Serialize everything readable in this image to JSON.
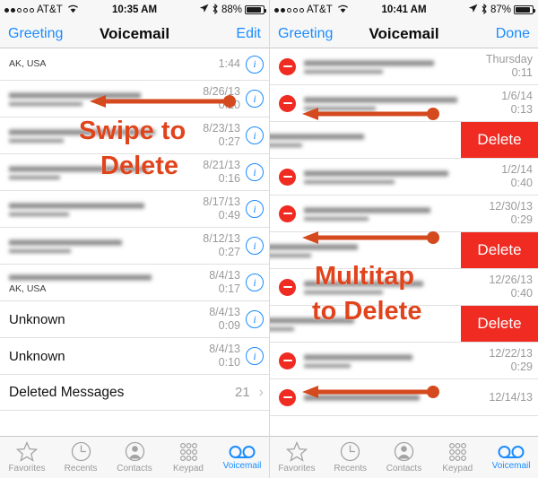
{
  "left": {
    "status": {
      "carrier": "AT&T",
      "signal_filled": 2,
      "signal_total": 5,
      "time": "10:35 AM",
      "battery": "88%"
    },
    "nav": {
      "left": "Greeting",
      "title": "Voicemail",
      "right": "Edit"
    },
    "rows": [
      {
        "name": "",
        "sub": "AK, USA",
        "date": "",
        "dur": "1:44",
        "blur_name": true,
        "partial": true
      },
      {
        "name": "",
        "sub": "",
        "date": "8/26/13",
        "dur": "0:20",
        "blur_name": true,
        "blur_sub": true
      },
      {
        "name": "",
        "sub": "",
        "date": "8/23/13",
        "dur": "0:27",
        "blur_name": true,
        "blur_sub": true
      },
      {
        "name": "",
        "sub": "",
        "date": "8/21/13",
        "dur": "0:16",
        "blur_name": true,
        "blur_sub": true
      },
      {
        "name": "",
        "sub": "",
        "date": "8/17/13",
        "dur": "0:49",
        "blur_name": true,
        "blur_sub": true
      },
      {
        "name": "",
        "sub": "",
        "date": "8/12/13",
        "dur": "0:27",
        "blur_name": true,
        "blur_sub": true
      },
      {
        "name": "",
        "sub": "AK, USA",
        "date": "8/4/13",
        "dur": "0:17",
        "blur_name": true
      },
      {
        "name": "Unknown",
        "sub": "",
        "date": "8/4/13",
        "dur": "0:09"
      },
      {
        "name": "Unknown",
        "sub": "",
        "date": "8/4/13",
        "dur": "0:10"
      }
    ],
    "deleted": {
      "label": "Deleted Messages",
      "count": "21",
      "chevron": "›"
    },
    "annotation": {
      "line1": "Swipe to",
      "line2": "Delete"
    }
  },
  "right": {
    "status": {
      "carrier": "AT&T",
      "signal_filled": 2,
      "signal_total": 5,
      "time": "10:41 AM",
      "battery": "87%"
    },
    "nav": {
      "left": "Greeting",
      "title": "Voicemail",
      "right": "Done"
    },
    "rows": [
      {
        "mode": "edit",
        "date": "Thursday",
        "dur": "0:11"
      },
      {
        "mode": "edit",
        "date": "1/6/14",
        "dur": "0:13"
      },
      {
        "mode": "swiped",
        "delete_label": "Delete"
      },
      {
        "mode": "edit",
        "date": "1/2/14",
        "dur": "0:40"
      },
      {
        "mode": "edit",
        "date": "12/30/13",
        "dur": "0:29"
      },
      {
        "mode": "swiped",
        "delete_label": "Delete"
      },
      {
        "mode": "edit",
        "date": "12/26/13",
        "dur": "0:40"
      },
      {
        "mode": "swiped",
        "delete_label": "Delete"
      },
      {
        "mode": "edit",
        "date": "12/22/13",
        "dur": "0:29"
      },
      {
        "mode": "edit",
        "date": "12/14/13",
        "dur": ""
      }
    ],
    "annotation": {
      "line1": "Multitap",
      "line2": "to Delete"
    }
  },
  "tabs": [
    {
      "label": "Favorites",
      "icon": "star-icon",
      "active": false
    },
    {
      "label": "Recents",
      "icon": "clock-icon",
      "active": false
    },
    {
      "label": "Contacts",
      "icon": "person-icon",
      "active": false
    },
    {
      "label": "Keypad",
      "icon": "keypad-icon",
      "active": false
    },
    {
      "label": "Voicemail",
      "icon": "voicemail-icon",
      "active": true
    }
  ],
  "colors": {
    "accent_blue": "#1a8cff",
    "delete_red": "#ef2b22",
    "annotation_orange": "#e0441c"
  }
}
